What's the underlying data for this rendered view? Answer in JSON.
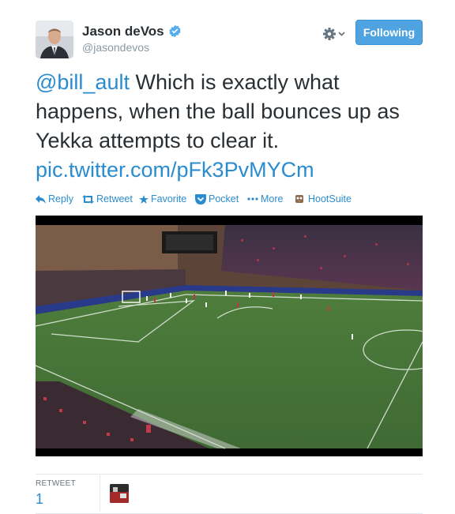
{
  "author": {
    "name": "Jason deVos",
    "handle": "@jasondevos",
    "verified": true
  },
  "follow_button": {
    "label": "Following"
  },
  "tweet": {
    "mention": "@bill_ault",
    "body": " Which is exactly what happens, when the ball bounces up as Yekka attempts to clear it. ",
    "link": "pic.twitter.com/pFk3PvMYCm"
  },
  "actions": {
    "reply": "Reply",
    "retweet": "Retweet",
    "favorite": "Favorite",
    "pocket": "Pocket",
    "more": "More",
    "hootsuite": "HootSuite"
  },
  "stats": {
    "retweet_label": "RETWEET",
    "retweet_count": "1"
  },
  "colors": {
    "link": "#2a8ccf",
    "follow_bg": "#4fa3e0",
    "pitch": "#3f6a34"
  }
}
